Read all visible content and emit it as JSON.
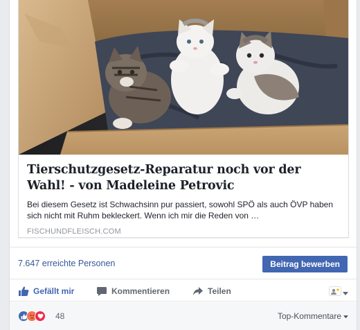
{
  "link_preview": {
    "title": "Tierschutzgesetz-Reparatur noch vor der Wahl! - von Madeleine Petrovic",
    "description": "Bei diesem Gesetz ist Schwachsinn pur passiert, sowohl SPÖ als auch ÖVP haben sich nicht mit Ruhm bekleckert. Wenn ich mir die Reden von …",
    "domain": "FISCHUNDFLEISCH.COM"
  },
  "insights": {
    "reach_text": "7.647 erreichte Personen",
    "boost_label": "Beitrag bewerben"
  },
  "actions": {
    "like_label": "Gefällt mir",
    "comment_label": "Kommentieren",
    "share_label": "Teilen"
  },
  "reactions": {
    "count": "48",
    "types": [
      "like-icon",
      "angry-icon",
      "love-icon"
    ],
    "sort_label": "Top-Kommentare"
  },
  "colors": {
    "facebook_blue": "#4267b2",
    "link_blue": "#365899",
    "love_red": "#f0284a",
    "angry_orange": "#f7714c"
  }
}
